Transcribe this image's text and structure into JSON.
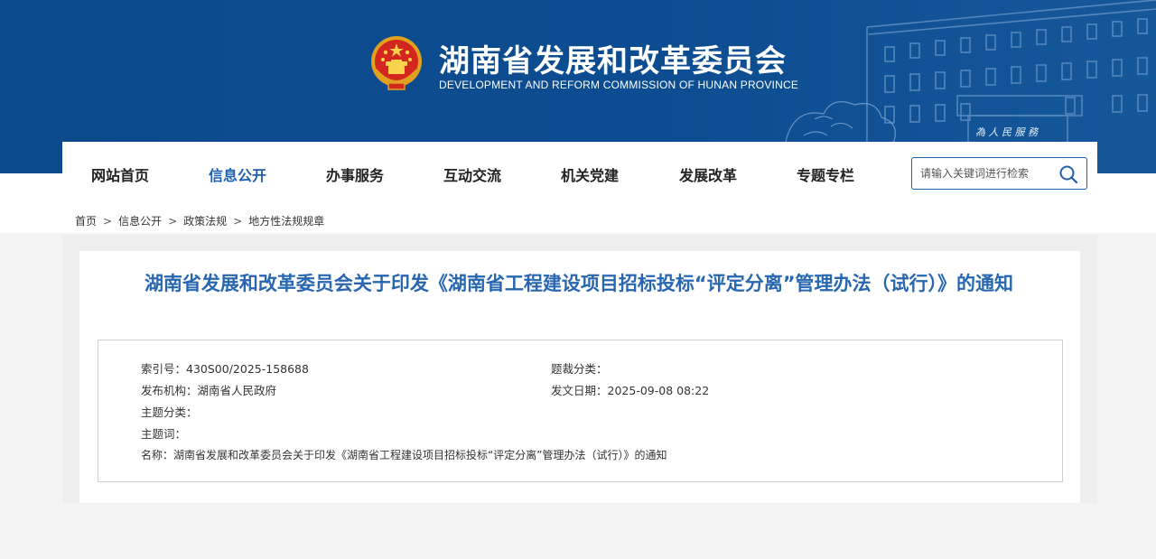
{
  "header": {
    "title": "湖南省发展和改革委员会",
    "subtitle": "DEVELOPMENT AND REFORM COMMISSION OF HUNAN PROVINCE",
    "emblem_icon": "national-emblem-icon",
    "banner_color": "#0d4a8c"
  },
  "nav": {
    "items": [
      {
        "label": "网站首页",
        "active": false
      },
      {
        "label": "信息公开",
        "active": true
      },
      {
        "label": "办事服务",
        "active": false
      },
      {
        "label": "互动交流",
        "active": false
      },
      {
        "label": "机关党建",
        "active": false
      },
      {
        "label": "发展改革",
        "active": false
      },
      {
        "label": "专题专栏",
        "active": false
      }
    ],
    "active_color": "#1e5fae"
  },
  "search": {
    "placeholder": "请输入关键词进行检索",
    "value": "",
    "icon": "search-icon"
  },
  "breadcrumb": {
    "items": [
      "首页",
      "信息公开",
      "政策法规",
      "地方性法规规章"
    ],
    "separator": ">"
  },
  "article": {
    "title": "湖南省发展和改革委员会关于印发《湖南省工程建设项目招标投标“评定分离”管理办法（试行）》的通知",
    "title_color": "#2867b0",
    "meta": {
      "index_no": {
        "label": "索引号：",
        "value": "430S00/2025-158688"
      },
      "genre": {
        "label": "题裁分类：",
        "value": ""
      },
      "publisher": {
        "label": "发布机构：",
        "value": "湖南省人民政府"
      },
      "date": {
        "label": "发文日期：",
        "value": "2025-09-08 08:22"
      },
      "topic_class": {
        "label": "主题分类：",
        "value": ""
      },
      "keywords": {
        "label": "主题词：",
        "value": ""
      },
      "name": {
        "label": "名称：",
        "value": "湖南省发展和改革委员会关于印发《湖南省工程建设项目招标投标“评定分离”管理办法（试行）》的通知"
      }
    }
  }
}
